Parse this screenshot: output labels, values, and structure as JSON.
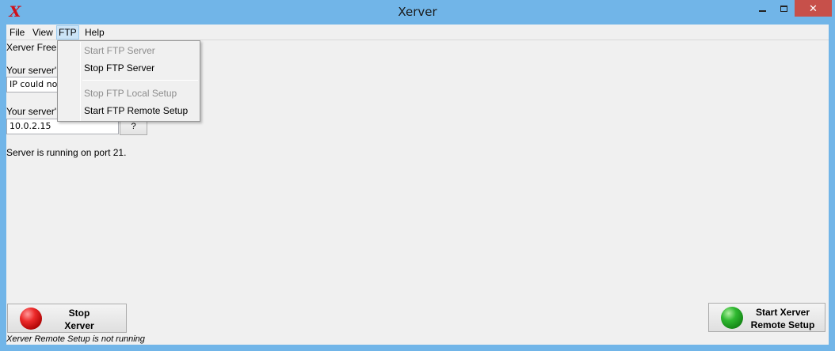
{
  "window": {
    "title": "Xerver",
    "icon": "X",
    "controls": {
      "minimize": "minimize-icon",
      "maximize": "maximize-icon",
      "close": "✕"
    }
  },
  "menubar": {
    "items": [
      "File",
      "View",
      "FTP",
      "Help"
    ]
  },
  "ftp_menu": {
    "items": [
      {
        "label": "Start FTP Server",
        "enabled": false
      },
      {
        "label": "Stop FTP Server",
        "enabled": true
      },
      {
        "label": "Stop FTP Local Setup",
        "enabled": false
      },
      {
        "label": "Start FTP Remote Setup",
        "enabled": true
      }
    ]
  },
  "main": {
    "heading_partial": "Xerver Free",
    "server_ip_label_partial": "Your server'",
    "server_ip_value": "IP could not b",
    "local_ip_label_partial": "Your server'",
    "local_ip_value": "10.0.2.15",
    "help_button": "?",
    "status": "Server is running on port 21."
  },
  "buttons": {
    "stop": {
      "line1": "Stop",
      "line2": "Xerver",
      "color": "#e02020"
    },
    "remote": {
      "line1": "Start Xerver",
      "line2": "Remote Setup",
      "color": "#22a022"
    }
  },
  "footer": {
    "remote_status": "Xerver Remote Setup is not running"
  }
}
